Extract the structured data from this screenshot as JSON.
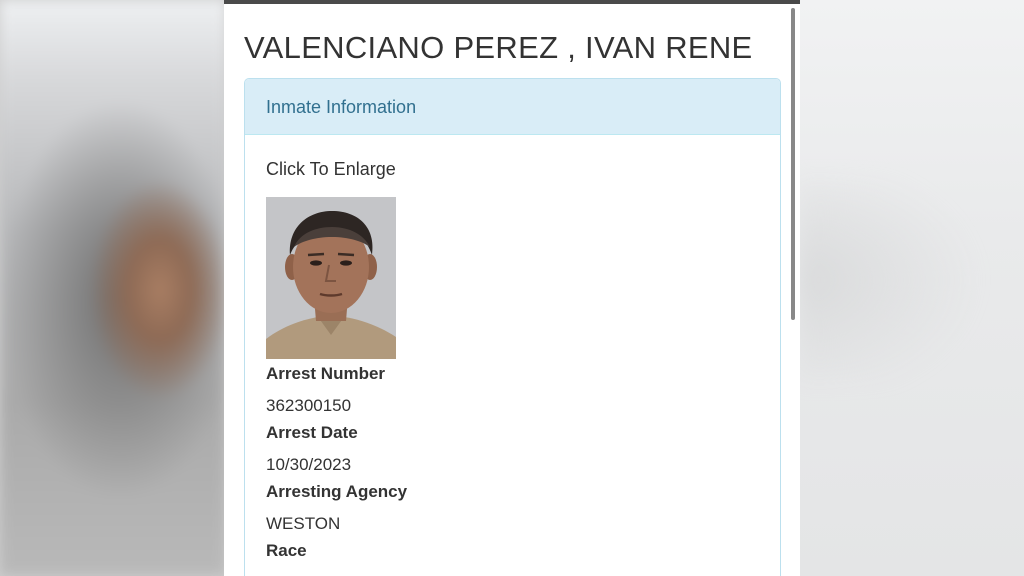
{
  "page_title": "VALENCIANO PEREZ , IVAN RENE",
  "panel": {
    "heading": "Inmate Information",
    "enlarge_link": "Click To Enlarge",
    "photo_icon": "mugshot-photo",
    "fields": [
      {
        "label": "Arrest Number",
        "value": "362300150"
      },
      {
        "label": "Arrest Date",
        "value": "10/30/2023"
      },
      {
        "label": "Arresting Agency",
        "value": "WESTON"
      },
      {
        "label": "Race",
        "value": ""
      }
    ]
  },
  "colors": {
    "panel_heading_bg": "#d9edf7",
    "panel_heading_text": "#31708f",
    "panel_border": "#bce0ee",
    "text": "#333333"
  }
}
